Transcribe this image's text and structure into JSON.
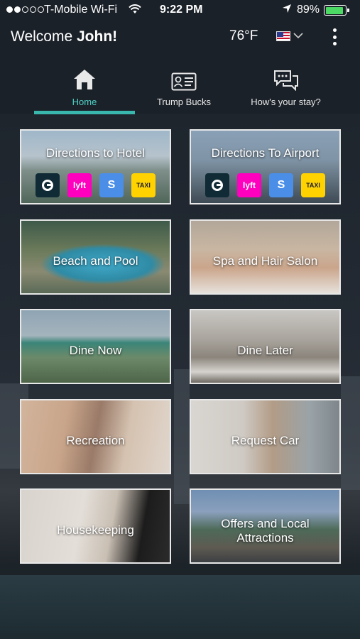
{
  "status_bar": {
    "carrier": "T-Mobile Wi-Fi",
    "time": "9:22 PM",
    "battery": "89%",
    "battery_level": 0.89
  },
  "header": {
    "welcome": "Welcome",
    "user": "John!",
    "temperature": "76°F"
  },
  "tabs": [
    {
      "label": "Home",
      "icon": "home-icon",
      "active": true
    },
    {
      "label": "Trump Bucks",
      "icon": "id-card-icon",
      "active": false
    },
    {
      "label": "How's your stay?",
      "icon": "chat-bubbles-icon",
      "active": false
    }
  ],
  "tiles": {
    "directions_hotel": "Directions to Hotel",
    "directions_airport": "Directions To Airport",
    "beach_pool": "Beach and Pool",
    "spa_salon": "Spa and Hair Salon",
    "dine_now": "Dine Now",
    "dine_later": "Dine Later",
    "recreation": "Recreation",
    "request_car": "Request Car",
    "housekeeping": "Housekeeping",
    "offers_line1": "Offers and Local",
    "offers_line2": "Attractions"
  },
  "ride_services": [
    {
      "name": "uber-icon"
    },
    {
      "name": "lyft-icon",
      "text": "lyft"
    },
    {
      "name": "curb-icon",
      "text": "S"
    },
    {
      "name": "taxi-icon",
      "text": "TAXI"
    }
  ],
  "colors": {
    "accent": "#3ab7ad",
    "background": "#1b2129",
    "battery": "#4cd964"
  }
}
